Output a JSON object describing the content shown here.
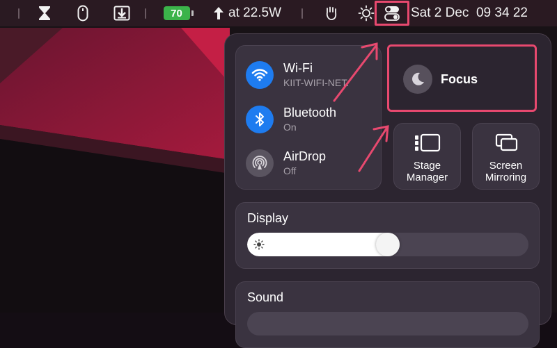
{
  "menubar": {
    "battery_level": "70",
    "power_text": "at 22.5W",
    "datetime": "Sat 2 Dec  09 34 22",
    "icons": [
      "hourglass-icon",
      "mouse-icon",
      "download-icon",
      "battery-icon",
      "power-arrow-icon",
      "hand-icon",
      "brightness-icon",
      "control-center-icon"
    ]
  },
  "control_center": {
    "connectivity": [
      {
        "title": "Wi-Fi",
        "subtitle": "KIIT-WIFI-NET.",
        "state": "on",
        "icon": "wifi-icon"
      },
      {
        "title": "Bluetooth",
        "subtitle": "On",
        "state": "on",
        "icon": "bluetooth-icon"
      },
      {
        "title": "AirDrop",
        "subtitle": "Off",
        "state": "off",
        "icon": "airdrop-icon"
      }
    ],
    "focus": {
      "label": "Focus",
      "icon": "moon-icon"
    },
    "stage_manager": {
      "line1": "Stage",
      "line2": "Manager",
      "icon": "stage-manager-icon"
    },
    "screen_mirroring": {
      "line1": "Screen",
      "line2": "Mirroring",
      "icon": "screen-mirroring-icon"
    },
    "display": {
      "title": "Display",
      "brightness_fraction": 0.5
    },
    "sound": {
      "title": "Sound"
    }
  },
  "colors": {
    "accent_blue": "#1e7cf0",
    "highlight_pink": "#e8496f",
    "battery_green": "#3bb34a"
  }
}
